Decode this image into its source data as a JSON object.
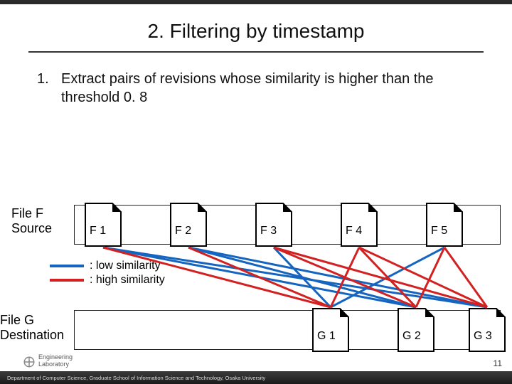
{
  "title": "2. Filtering by timestamp",
  "bullet": {
    "num": "1.",
    "text": "Extract pairs of revisions whose similarity is higher than the threshold 0. 8"
  },
  "fileF": {
    "label": "File F\nSource",
    "docs": [
      "F 1",
      "F 2",
      "F 3",
      "F 4",
      "F 5"
    ]
  },
  "fileG": {
    "label": "File G\nDestination",
    "docs": [
      "G 1",
      "G 2",
      "G 3"
    ]
  },
  "legend": {
    "low": ": low similarity",
    "high": ": high similarity"
  },
  "colors": {
    "low": "#1565c0",
    "high": "#d32020",
    "track_border": "#222222"
  },
  "pairs_high": [
    [
      "F1",
      "G1"
    ],
    [
      "F2",
      "G1"
    ],
    [
      "F3",
      "G2"
    ],
    [
      "F3",
      "G3"
    ],
    [
      "F4",
      "G1"
    ],
    [
      "F4",
      "G2"
    ],
    [
      "F4",
      "G3"
    ],
    [
      "F5",
      "G2"
    ],
    [
      "F5",
      "G3"
    ]
  ],
  "pairs_low": [
    [
      "F1",
      "G2"
    ],
    [
      "F1",
      "G3"
    ],
    [
      "F2",
      "G2"
    ],
    [
      "F2",
      "G3"
    ],
    [
      "F3",
      "G1"
    ],
    [
      "F5",
      "G1"
    ]
  ],
  "lab": {
    "line1": "Engineering",
    "line2": "Laboratory"
  },
  "footer": "Department of Computer Science, Graduate School of Information Science and Technology, Osaka University",
  "page_num": "11"
}
